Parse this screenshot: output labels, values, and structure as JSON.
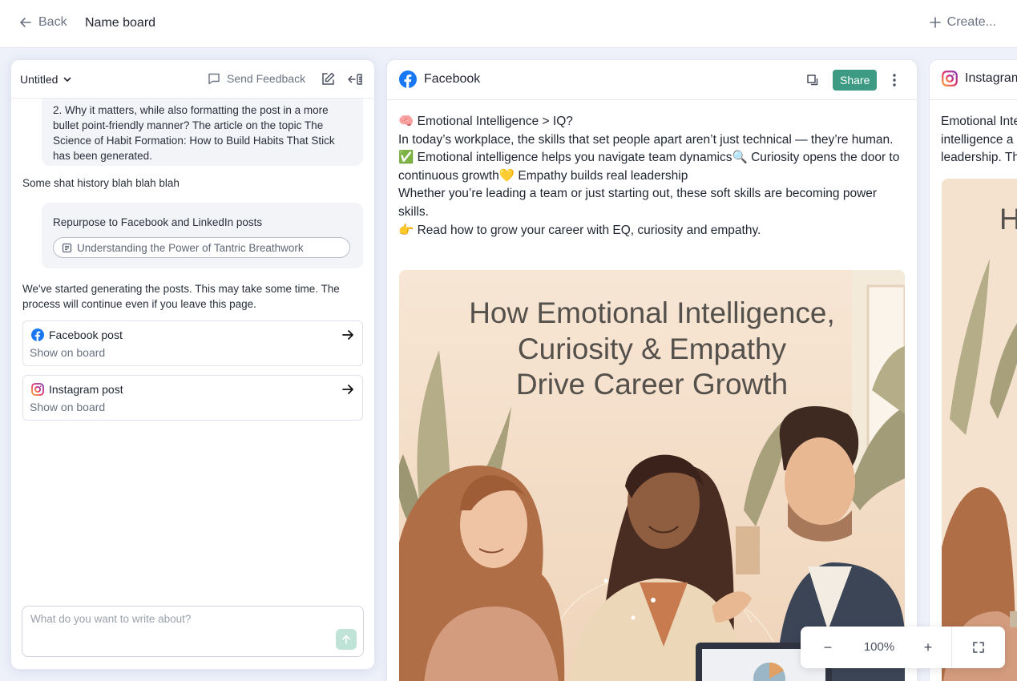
{
  "topbar": {
    "back_label": "Back",
    "board_name": "Name board",
    "create_label": "Create..."
  },
  "chat": {
    "title": "Untitled",
    "feedback_label": "Send Feedback",
    "messages": {
      "bubble1": "2. Why it matters, while also formatting the post in a more bullet point-friendly manner? The article on the topic The Science of Habit Formation: How to Build Habits That Stick has been generated.",
      "history": "Some shat history blah blah blah",
      "repurpose": "Repurpose to Facebook and LinkedIn posts",
      "article_chip": "Understanding the Power of Tantric Breathwork",
      "status": "We've started generating the posts. This may take some time. The process will continue even if you leave this page."
    },
    "posts": [
      {
        "title": "Facebook post",
        "action": "Show on board",
        "icon": "facebook-icon"
      },
      {
        "title": "Instagram post",
        "action": "Show on board",
        "icon": "instagram-icon"
      }
    ],
    "composer_placeholder": "What do you want to write about?"
  },
  "facebook_card": {
    "platform": "Facebook",
    "share_label": "Share",
    "post_lines": [
      "🧠 Emotional Intelligence > IQ?",
      "In today’s workplace, the skills that set people apart aren’t just technical — they’re human.",
      "✅ Emotional intelligence helps you navigate team dynamics🔍 Curiosity opens the door to continuous growth💛 Empathy builds real leadership",
      "Whether you’re leading a team or just starting out, these soft skills are becoming power skills.",
      "👉 Read how to grow your career with EQ, curiosity and empathy."
    ],
    "image_title_lines": [
      "How Emotional Intelligence,",
      "Curiosity & Empathy",
      "Drive Career Growth"
    ]
  },
  "instagram_card": {
    "platform": "Instagram",
    "text_lines": [
      "Emotional Inte",
      "intelligence a",
      "leadership. Th"
    ],
    "image_letter": "H"
  },
  "zoom": {
    "minus": "−",
    "value": "100%",
    "plus": "+"
  },
  "colors": {
    "accent": "#3d9a83",
    "send_button": "#bfe3d6",
    "facebook_blue": "#1877f2",
    "canvas_background": "#eef1f9"
  }
}
